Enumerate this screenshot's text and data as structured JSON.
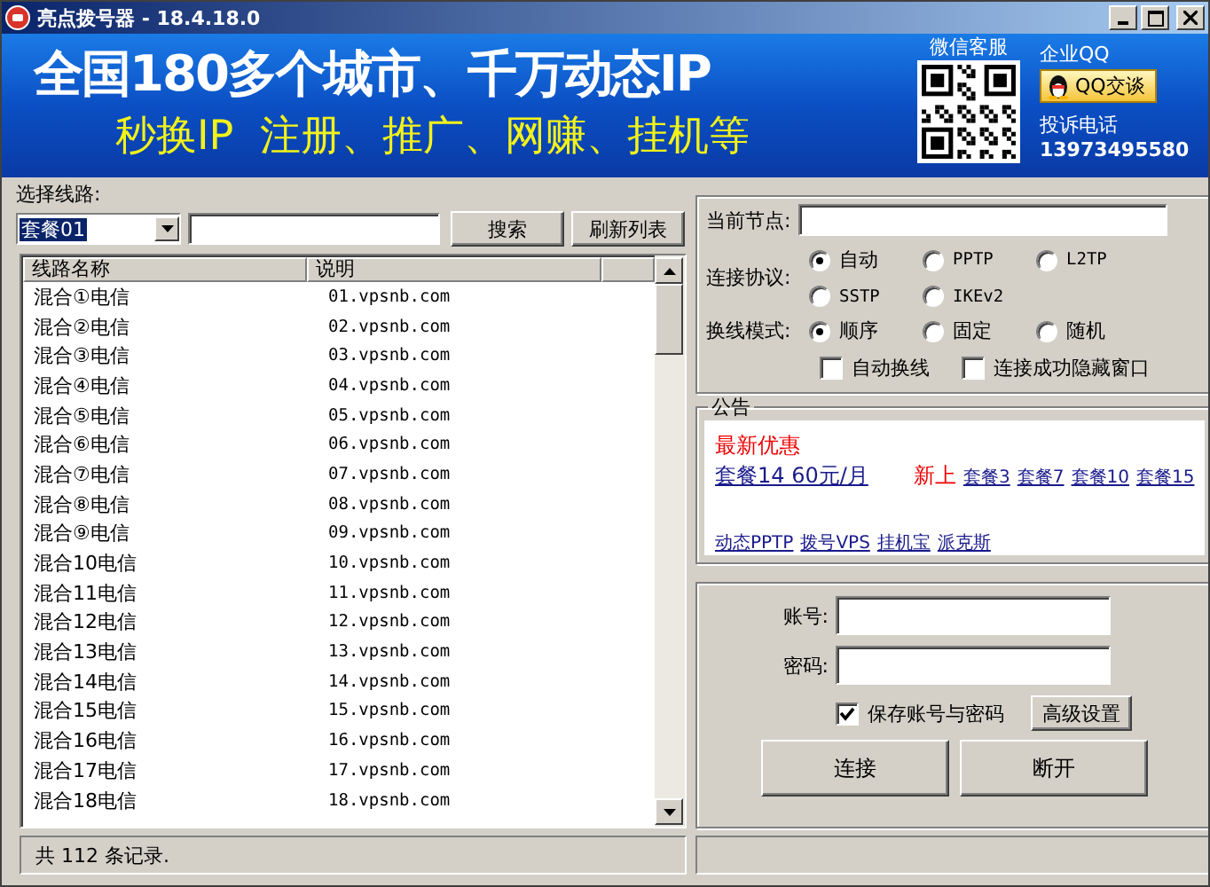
{
  "window": {
    "title": "亮点拨号器 - 18.4.18.0"
  },
  "banner": {
    "headline": "全国180多个城市、千万动态IP",
    "subline": "秒换IP  注册、推广、网赚、挂机等",
    "wechat_label": "微信客服",
    "qq_label": "企业QQ",
    "qq_button": "QQ交谈",
    "complaint_label": "投诉电话",
    "phone": "13973495580"
  },
  "line_picker": {
    "label": "选择线路:",
    "package": "套餐01",
    "search_button": "搜索",
    "refresh_button": "刷新列表"
  },
  "table": {
    "columns": [
      "线路名称",
      "说明"
    ],
    "rows": [
      [
        "混合①电信",
        "01.vpsnb.com"
      ],
      [
        "混合②电信",
        "02.vpsnb.com"
      ],
      [
        "混合③电信",
        "03.vpsnb.com"
      ],
      [
        "混合④电信",
        "04.vpsnb.com"
      ],
      [
        "混合⑤电信",
        "05.vpsnb.com"
      ],
      [
        "混合⑥电信",
        "06.vpsnb.com"
      ],
      [
        "混合⑦电信",
        "07.vpsnb.com"
      ],
      [
        "混合⑧电信",
        "08.vpsnb.com"
      ],
      [
        "混合⑨电信",
        "09.vpsnb.com"
      ],
      [
        "混合10电信",
        "10.vpsnb.com"
      ],
      [
        "混合11电信",
        "11.vpsnb.com"
      ],
      [
        "混合12电信",
        "12.vpsnb.com"
      ],
      [
        "混合13电信",
        "13.vpsnb.com"
      ],
      [
        "混合14电信",
        "14.vpsnb.com"
      ],
      [
        "混合15电信",
        "15.vpsnb.com"
      ],
      [
        "混合16电信",
        "16.vpsnb.com"
      ],
      [
        "混合17电信",
        "17.vpsnb.com"
      ],
      [
        "混合18电信",
        "18.vpsnb.com"
      ]
    ]
  },
  "status_bar": {
    "text": "共 112 条记录."
  },
  "connection": {
    "node_label": "当前节点:",
    "protocol_label": "连接协议:",
    "protocols": [
      {
        "label": "自动",
        "selected": true
      },
      {
        "label": "PPTP",
        "selected": false
      },
      {
        "label": "L2TP",
        "selected": false
      },
      {
        "label": "SSTP",
        "selected": false
      },
      {
        "label": "IKEv2",
        "selected": false
      }
    ],
    "mode_label": "换线模式:",
    "modes": [
      {
        "label": "顺序",
        "selected": true
      },
      {
        "label": "固定",
        "selected": false
      },
      {
        "label": "随机",
        "selected": false
      }
    ],
    "options": [
      {
        "label": "自动换线",
        "checked": false
      },
      {
        "label": "连接成功隐藏窗口",
        "checked": false
      }
    ]
  },
  "notice": {
    "title": "公告",
    "lines": [
      [
        {
          "kind": "highlight",
          "text": "最新优惠"
        }
      ],
      [
        {
          "kind": "biglink",
          "text": "套餐14 60元/月"
        },
        {
          "kind": "highlight",
          "text": "新上"
        },
        {
          "kind": "link",
          "text": "套餐3"
        },
        {
          "kind": "link",
          "text": "套餐7"
        },
        {
          "kind": "link",
          "text": "套餐10"
        },
        {
          "kind": "link",
          "text": "套餐15"
        }
      ],
      [
        {
          "kind": "link",
          "text": "动态PPTP"
        },
        {
          "kind": "link",
          "text": "拨号VPS"
        },
        {
          "kind": "link",
          "text": "挂机宝"
        },
        {
          "kind": "link",
          "text": "派克斯"
        }
      ]
    ]
  },
  "login": {
    "account_label": "账号:",
    "password_label": "密码:",
    "save": {
      "label": "保存账号与密码",
      "checked": true
    },
    "advanced_button": "高级设置",
    "connect_button": "连接",
    "disconnect_button": "断开"
  }
}
